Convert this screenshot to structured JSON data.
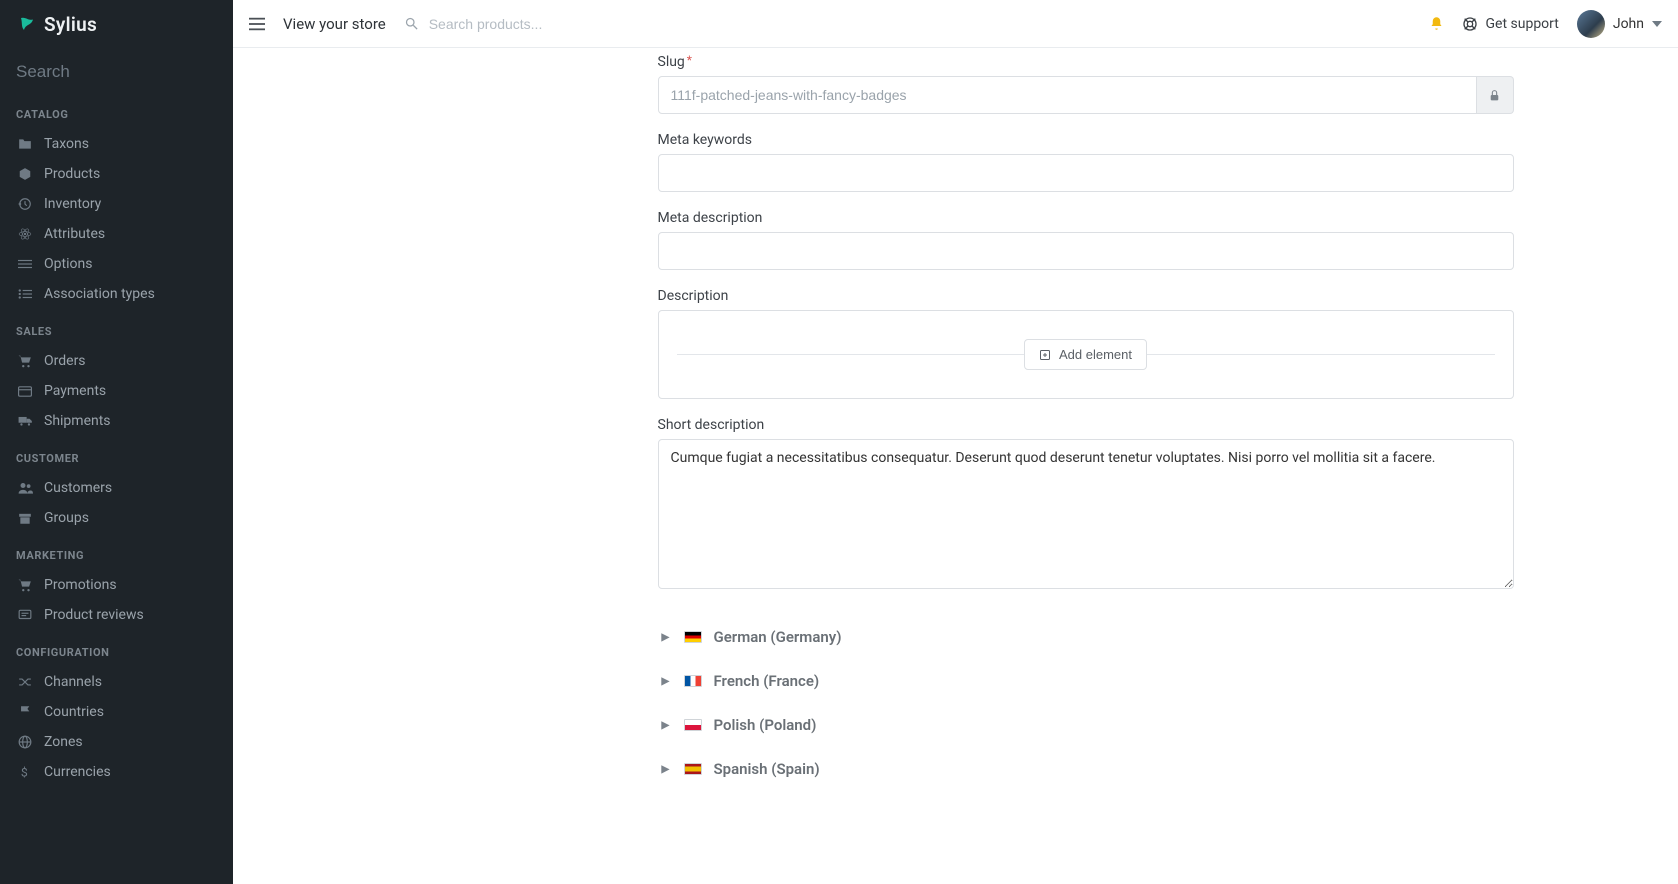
{
  "brand": "Sylius",
  "sidebar": {
    "search_placeholder": "Search",
    "sections": [
      {
        "title": "CATALOG",
        "items": [
          {
            "label": "Taxons",
            "icon": "folder-icon"
          },
          {
            "label": "Products",
            "icon": "cube-icon"
          },
          {
            "label": "Inventory",
            "icon": "history-icon"
          },
          {
            "label": "Attributes",
            "icon": "atom-icon"
          },
          {
            "label": "Options",
            "icon": "sliders-icon"
          },
          {
            "label": "Association types",
            "icon": "list-icon"
          }
        ]
      },
      {
        "title": "SALES",
        "items": [
          {
            "label": "Orders",
            "icon": "cart-icon"
          },
          {
            "label": "Payments",
            "icon": "payments-icon"
          },
          {
            "label": "Shipments",
            "icon": "truck-icon"
          }
        ]
      },
      {
        "title": "CUSTOMER",
        "items": [
          {
            "label": "Customers",
            "icon": "users-icon"
          },
          {
            "label": "Groups",
            "icon": "archive-icon"
          }
        ]
      },
      {
        "title": "MARKETING",
        "items": [
          {
            "label": "Promotions",
            "icon": "cart-icon"
          },
          {
            "label": "Product reviews",
            "icon": "review-icon"
          }
        ]
      },
      {
        "title": "CONFIGURATION",
        "items": [
          {
            "label": "Channels",
            "icon": "random-icon"
          },
          {
            "label": "Countries",
            "icon": "flag-icon"
          },
          {
            "label": "Zones",
            "icon": "globe-icon"
          },
          {
            "label": "Currencies",
            "icon": "dollar-icon"
          }
        ]
      }
    ]
  },
  "topbar": {
    "view_store": "View your store",
    "search_placeholder": "Search products...",
    "support": "Get support",
    "user_name": "John"
  },
  "form": {
    "slug_label": "Slug",
    "slug_value": "111f-patched-jeans-with-fancy-badges",
    "meta_keywords_label": "Meta keywords",
    "meta_keywords_value": "",
    "meta_description_label": "Meta description",
    "meta_description_value": "",
    "description_label": "Description",
    "add_element_label": "Add element",
    "short_description_label": "Short description",
    "short_description_value": "Cumque fugiat a necessitatibus consequatur. Deserunt quod deserunt tenetur voluptates. Nisi porro vel mollitia sit a facere."
  },
  "languages": [
    {
      "label": "German (Germany)",
      "flag": "flag-de"
    },
    {
      "label": "French (France)",
      "flag": "flag-fr"
    },
    {
      "label": "Polish (Poland)",
      "flag": "flag-pl"
    },
    {
      "label": "Spanish (Spain)",
      "flag": "flag-es"
    }
  ]
}
